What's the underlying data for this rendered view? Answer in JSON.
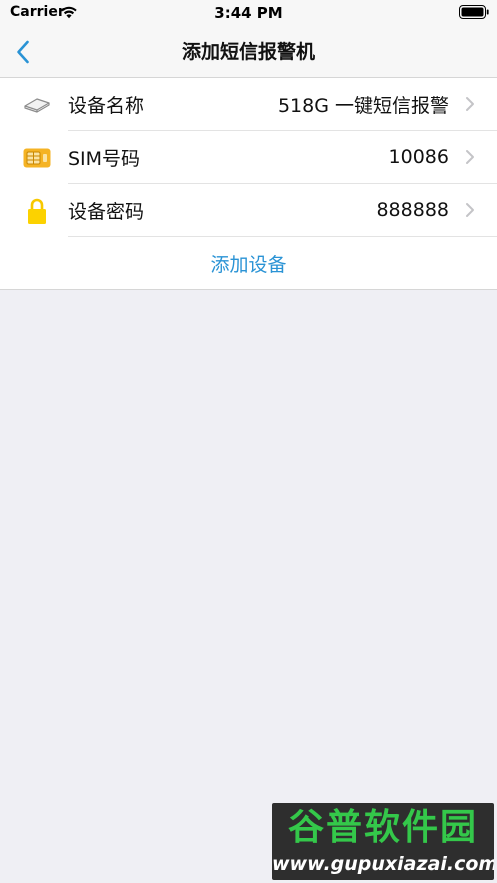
{
  "status_bar": {
    "carrier": "Carrier",
    "time": "3:44 PM",
    "wifi_icon": "wifi-icon",
    "battery_icon": "battery-icon"
  },
  "nav": {
    "title": "添加短信报警机",
    "back_icon": "chevron-left-icon",
    "accent_color": "#2a93d5"
  },
  "form": {
    "rows": [
      {
        "label": "设备名称",
        "value": "518G 一键短信报警",
        "icon": "device-icon"
      },
      {
        "label": "SIM号码",
        "value": "10086",
        "icon": "sim-card-icon"
      },
      {
        "label": "设备密码",
        "value": "888888",
        "icon": "lock-icon"
      }
    ],
    "add_button_label": "添加设备"
  },
  "watermark": {
    "title": "谷普软件园",
    "url": "www.gupuxiazai.com"
  }
}
